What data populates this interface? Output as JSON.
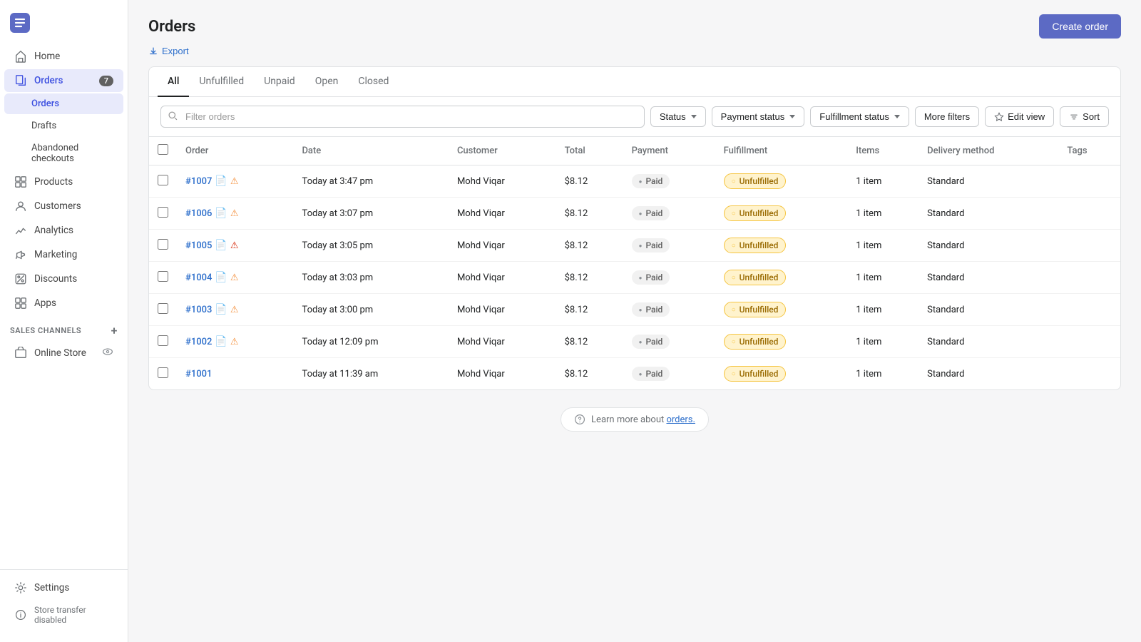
{
  "sidebar": {
    "nav_items": [
      {
        "id": "home",
        "label": "Home",
        "icon": "home",
        "active": false,
        "badge": null
      },
      {
        "id": "orders",
        "label": "Orders",
        "icon": "orders",
        "active": true,
        "badge": "7"
      },
      {
        "id": "products",
        "label": "Products",
        "icon": "products",
        "active": false,
        "badge": null
      },
      {
        "id": "customers",
        "label": "Customers",
        "icon": "customers",
        "active": false,
        "badge": null
      },
      {
        "id": "analytics",
        "label": "Analytics",
        "icon": "analytics",
        "active": false,
        "badge": null
      },
      {
        "id": "marketing",
        "label": "Marketing",
        "icon": "marketing",
        "active": false,
        "badge": null
      },
      {
        "id": "discounts",
        "label": "Discounts",
        "icon": "discounts",
        "active": false,
        "badge": null
      },
      {
        "id": "apps",
        "label": "Apps",
        "icon": "apps",
        "active": false,
        "badge": null
      }
    ],
    "orders_sub": [
      {
        "id": "orders-sub",
        "label": "Orders",
        "active": true
      },
      {
        "id": "drafts",
        "label": "Drafts",
        "active": false
      },
      {
        "id": "abandoned",
        "label": "Abandoned checkouts",
        "active": false
      }
    ],
    "sales_channels_label": "SALES CHANNELS",
    "online_store": "Online Store",
    "settings_label": "Settings",
    "store_transfer_label": "Store transfer disabled"
  },
  "page": {
    "title": "Orders",
    "export_label": "Export",
    "create_order_label": "Create order"
  },
  "tabs": [
    {
      "id": "all",
      "label": "All",
      "active": true
    },
    {
      "id": "unfulfilled",
      "label": "Unfulfilled",
      "active": false
    },
    {
      "id": "unpaid",
      "label": "Unpaid",
      "active": false
    },
    {
      "id": "open",
      "label": "Open",
      "active": false
    },
    {
      "id": "closed",
      "label": "Closed",
      "active": false
    }
  ],
  "filters": {
    "search_placeholder": "Filter orders",
    "status_label": "Status",
    "payment_status_label": "Payment status",
    "fulfillment_status_label": "Fulfillment status",
    "more_filters_label": "More filters",
    "edit_view_label": "Edit view",
    "sort_label": "Sort"
  },
  "table": {
    "columns": [
      "Order",
      "Date",
      "Customer",
      "Total",
      "Payment",
      "Fulfillment",
      "Items",
      "Delivery method",
      "Tags"
    ],
    "rows": [
      {
        "id": "#1007",
        "date": "Today at 3:47 pm",
        "customer": "Mohd Viqar",
        "total": "$8.12",
        "payment": "Paid",
        "fulfillment": "Unfulfilled",
        "items": "1 item",
        "delivery": "Standard",
        "has_doc": true,
        "has_warn": true,
        "warn_red": false
      },
      {
        "id": "#1006",
        "date": "Today at 3:07 pm",
        "customer": "Mohd Viqar",
        "total": "$8.12",
        "payment": "Paid",
        "fulfillment": "Unfulfilled",
        "items": "1 item",
        "delivery": "Standard",
        "has_doc": true,
        "has_warn": true,
        "warn_red": false
      },
      {
        "id": "#1005",
        "date": "Today at 3:05 pm",
        "customer": "Mohd Viqar",
        "total": "$8.12",
        "payment": "Paid",
        "fulfillment": "Unfulfilled",
        "items": "1 item",
        "delivery": "Standard",
        "has_doc": true,
        "has_warn": true,
        "warn_red": true
      },
      {
        "id": "#1004",
        "date": "Today at 3:03 pm",
        "customer": "Mohd Viqar",
        "total": "$8.12",
        "payment": "Paid",
        "fulfillment": "Unfulfilled",
        "items": "1 item",
        "delivery": "Standard",
        "has_doc": true,
        "has_warn": true,
        "warn_red": false
      },
      {
        "id": "#1003",
        "date": "Today at 3:00 pm",
        "customer": "Mohd Viqar",
        "total": "$8.12",
        "payment": "Paid",
        "fulfillment": "Unfulfilled",
        "items": "1 item",
        "delivery": "Standard",
        "has_doc": true,
        "has_warn": true,
        "warn_red": false
      },
      {
        "id": "#1002",
        "date": "Today at 12:09 pm",
        "customer": "Mohd Viqar",
        "total": "$8.12",
        "payment": "Paid",
        "fulfillment": "Unfulfilled",
        "items": "1 item",
        "delivery": "Standard",
        "has_doc": true,
        "has_warn": true,
        "warn_red": false
      },
      {
        "id": "#1001",
        "date": "Today at 11:39 am",
        "customer": "Mohd Viqar",
        "total": "$8.12",
        "payment": "Paid",
        "fulfillment": "Unfulfilled",
        "items": "1 item",
        "delivery": "Standard",
        "has_doc": false,
        "has_warn": false,
        "warn_red": false
      }
    ]
  },
  "footer": {
    "learn_more_text": "Learn more about ",
    "learn_more_link": "orders."
  }
}
